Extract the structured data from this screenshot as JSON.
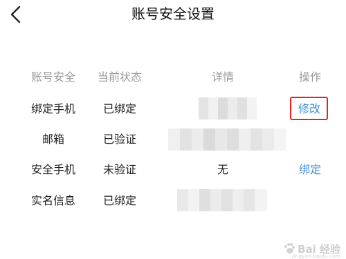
{
  "header": {
    "title": "账号安全设置",
    "back_icon": "chevron-left-icon"
  },
  "table": {
    "columns": [
      "账号安全",
      "当前状态",
      "详情",
      "操作"
    ],
    "rows": [
      {
        "item": "绑定手机",
        "status": "已绑定",
        "detail": "",
        "action": "修改"
      },
      {
        "item": "邮箱",
        "status": "已验证",
        "detail": "",
        "action": ""
      },
      {
        "item": "安全手机",
        "status": "未验证",
        "detail": "无",
        "action": "绑定"
      },
      {
        "item": "实名信息",
        "status": "已绑定",
        "detail": "",
        "action": ""
      }
    ]
  },
  "watermark": {
    "text": "Bai 经验",
    "subtext": "jingyan.baidu.com"
  },
  "colors": {
    "header_text": "#9a9a9a",
    "link": "#3c8ed8",
    "highlight_border": "#e0261f"
  }
}
